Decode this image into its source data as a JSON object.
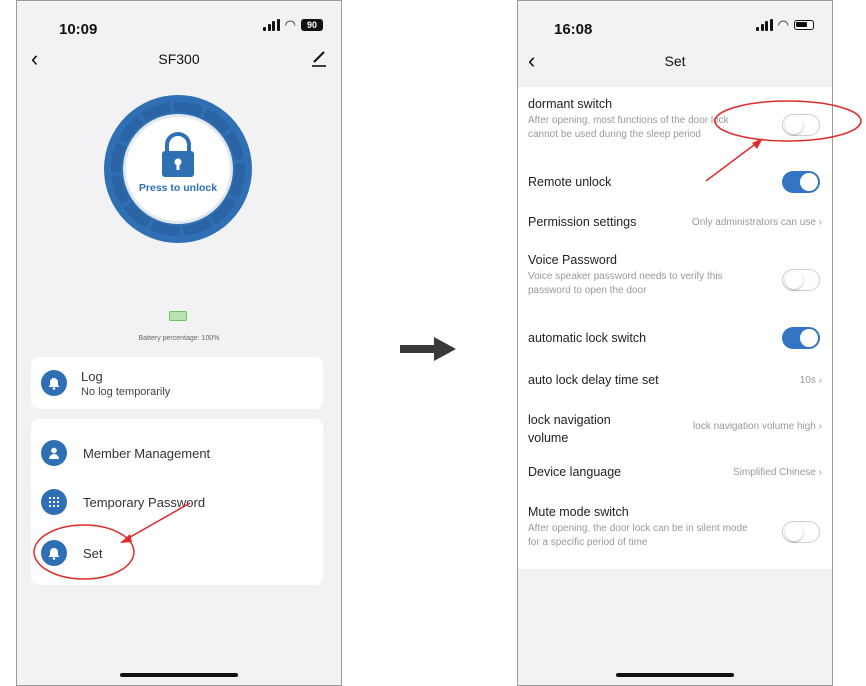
{
  "left_screen": {
    "status": {
      "time": "10:09",
      "battery": "90"
    },
    "nav": {
      "title": "SF300"
    },
    "unlock_button": {
      "label": "Press to unlock"
    },
    "battery_text": "Battery percentage: 100%",
    "log_card": {
      "title": "Log",
      "subtitle": "No log temporarily"
    },
    "menu": [
      {
        "label": "Member Management",
        "icon": "person-icon"
      },
      {
        "label": "Temporary Password",
        "icon": "keypad-icon"
      },
      {
        "label": "Set",
        "icon": "bell-icon"
      }
    ]
  },
  "right_screen": {
    "status": {
      "time": "16:08"
    },
    "nav": {
      "title": "Set"
    },
    "settings": [
      {
        "title": "dormant switch",
        "desc": "After opening, most functions of the door lock cannot be used during the sleep period",
        "control": "toggle",
        "on": false
      },
      {
        "title": "Remote unlock",
        "control": "toggle",
        "on": true
      },
      {
        "title": "Permission settings",
        "value": "Only administrators can use",
        "control": "link"
      },
      {
        "title": "Voice Password",
        "desc": "Voice speaker password needs to verify this password to open the door",
        "control": "toggle",
        "on": false
      },
      {
        "title": "automatic lock switch",
        "control": "toggle",
        "on": true
      },
      {
        "title": "auto lock delay time set",
        "value": "10s",
        "control": "link"
      },
      {
        "title": "lock navigation volume",
        "value": "lock navigation volume high",
        "control": "link"
      },
      {
        "title": "Device language",
        "value": "Simplified Chinese",
        "control": "link"
      },
      {
        "title": "Mute mode switch",
        "desc": "After opening, the door lock can be in silent mode for a specific period of time",
        "control": "toggle",
        "on": false
      }
    ]
  },
  "colors": {
    "accent": "#2f6fb4",
    "toggle_on": "#3374c4",
    "annotation": "#e02b2b"
  }
}
